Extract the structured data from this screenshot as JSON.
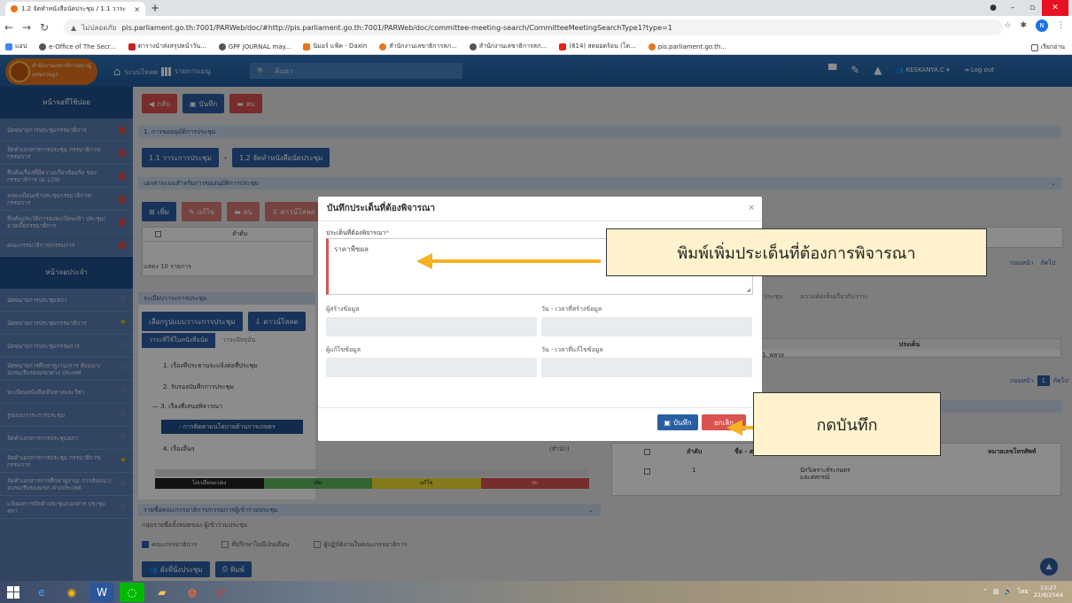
{
  "browser": {
    "tab_title": "1.2 จัดทำหนังสือนัดประชุม / 1.1 วาระ",
    "tab_close": "×",
    "new_tab": "+",
    "security_label": "ไม่ปลอดภัย",
    "url": "pis.parliament.go.th:7001/PARWeb/doc/#http://pis.parliament.go.th:7001/PARWeb/doc/committee-meeting-search/CommitteeMeetingSearchType1?type=1",
    "profile_initial": "N",
    "bookmarks": [
      "แอป",
      "e-Office of The Secr...",
      "ตารางนำส่งสรุปหน้าวัน...",
      "GPF JOURNAL may...",
      "นิมอร์ แฟ้ค - Daxin",
      "สำนักงานเลขาธิการสภ...",
      "สำนักงานเลขาธิการสภ...",
      "(814) สดยอดร้อน (โต...",
      "pis.parliament.go.th..."
    ],
    "reading_list": "เรียกอ่าน"
  },
  "app": {
    "logo_text": "สำนักงานเลขาธิการสภาผู้แทนราษฎร",
    "home_label": "ระบบไหลด",
    "menu_label": "รายการเมนู",
    "search_placeholder": "ค้นหา",
    "user_label": "KESKANYA.C",
    "logout_label": "Log out"
  },
  "sidebar": {
    "header1": "หน้าจอที่ใช้บ่อย",
    "items1": [
      "นัดหมายการประชุมกรรมาธิการ",
      "จัดทำเอกสารการประชุม กรรมาธิการ/กรรมการ",
      "สืบค้นเรื่องที่มีความเกี่ยวข้องกับ ของกรรมาธิการ (ม.129)",
      "ลงทะเบียนเข้าประชุมกรรมาธิการ/ กรรมการ",
      "สืบค้นประวัติการลงทะเบียนเข้า ประชุม/จ่ายเบี้ยกรรมาธิการ",
      "คณะกรรมาธิการ/กรรมการ"
    ],
    "header2": "หน้าจอประจำ",
    "items2": [
      "นัดหมายการประชุมสภา",
      "นัดหมายการประชุมกรรมาธิการ",
      "นัดหมายการประชุมกรรมการ",
      "นัดหมายการศึกษาดูงาน/การ สัมมนา/อบรม/รับรองแขกต่าง ประเทศ",
      "ทะเบียนหนังสือเดินทางและวีซ่า",
      "รูปแบบวาระการประชุม",
      "จัดทำเอกสารการประชุมสภา",
      "จัดทำเอกสารการประชุม กรรมาธิการ/กรรมการ",
      "จัดทำเอกสารการศึกษาดูงาน/ การสัมมนา/อบรม/รับรองแขก ต่างประเทศ",
      "แจ้งผลการจัดทำประชุม/เอกสาร ประชุมสภา"
    ]
  },
  "main": {
    "back": "กลับ",
    "save": "บันทึก",
    "delete": "ลบ",
    "section1": "1. การขออนุมัติการประชุม",
    "step1": "1.1 วาระการประชุม",
    "step2": "1.2 จัดทำหนังสือนัดประชุม",
    "section2": "เอกสารแนบสำหรับการขออนุมัติการประชุม",
    "add": "เพิ่ม",
    "edit": "แก้ไข",
    "del": "ลบ",
    "download": "ดาวน์โหลด",
    "col_order": "ลำดับ",
    "pager": "แสดง 10 รายการ",
    "agenda_section": "ระเบียบวาระการประชุม",
    "choose_agenda": "เลือกรูปแบบวาระการประชุม",
    "download2": "ดาวน์โหลด",
    "tab_on": "วาระที่ใช้ในหนังสือนัด",
    "tab_off": "วาระปัจจุบัน",
    "tree": [
      "1. เรื่องที่ประธานจะแจ้งต่อที่ประชุม",
      "2. รับรองบันทึกการประชุม",
      "3. เรื่องที่เสนอพิจารณา",
      "- การติดตามนโยบายด้านการเกษตร",
      "4. เรื่องอื่นๆ"
    ],
    "right_label": "(สำนัก)",
    "legend": [
      "ไม่เปลี่ยนแปลง",
      "เพิ่ม",
      "แก้ไข",
      "ลบ"
    ],
    "section3": "รายชื่อคณะกรรมาธิการ/กรรมการผู้เข้าร่วมประชุม",
    "group_label": "กลุ่มรายชื่อทั้งหมดของ ผู้เข้าร่วมประชุม",
    "chk1": "คณะกรรมาธิการ",
    "chk2": "ที่ปรึกษาไม่มีเงินเดือน",
    "chk3": "ผู้ปฏิบัติงานในคณะกรรมาธิการ",
    "btn_attendees": "ผังที่นั่งประชุม",
    "btn_print": "พิมพ์"
  },
  "right": {
    "prev": "ก่อนหน้า",
    "next": "ถัดไป",
    "tab_meeting": "ประชุม",
    "tab_opinion": "ความคิดเห็นเกี่ยวกับวาระ",
    "col_issue": "ประเด็น",
    "row1": "1. ผลวง",
    "page": "1",
    "col_no": "ลำดับ",
    "col_name": "ชื่อ - ส",
    "col_phone": "หมายเลขโทรศัพท์",
    "row_no": "1",
    "row_org": "นักวิเคราะห์ระกษตร และสหกรณ์"
  },
  "modal": {
    "title": "บันทึกประเด็นที่ต้องพิจารณา",
    "close": "×",
    "field_label": "ประเด็นที่ต้องพิจารณา",
    "required_mark": "*",
    "field_value": "ราคาพืชผล",
    "creator_label": "ผู้สร้างข้อมูล",
    "created_label": "วัน - เวลาที่สร้างข้อมูล",
    "editor_label": "ผู้แก้ไขข้อมูล",
    "edited_label": "วัน - เวลาที่แก้ไขข้อมูล",
    "save_label": "บันทึก",
    "cancel_label": "ยกเลิก"
  },
  "callouts": {
    "callout1": "พิมพ์เพิ่มประเด็นที่ต้องการพิจารณา",
    "callout2": "กดบันทึก"
  },
  "taskbar": {
    "time": "13:27",
    "date": "22/6/2564",
    "lang": "ไทย"
  }
}
